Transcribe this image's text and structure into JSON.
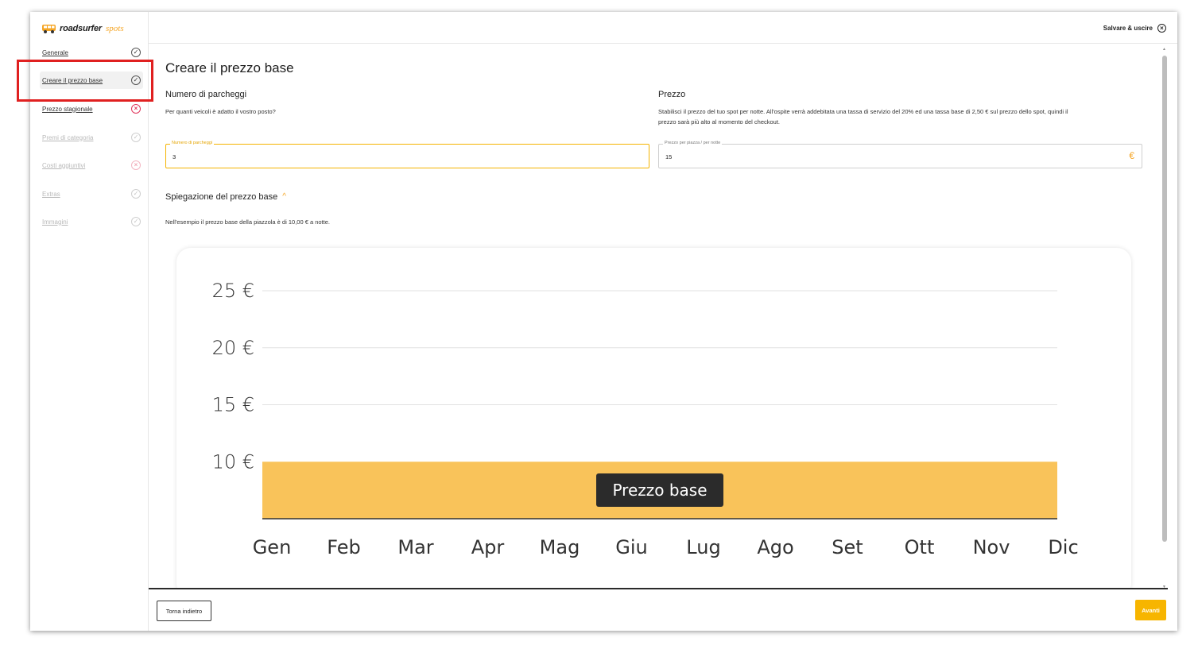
{
  "logo": {
    "brand": "roadsurfer",
    "suffix": "spots",
    "icon": "van-icon"
  },
  "sidebar": {
    "items": [
      {
        "label": "Generale",
        "status": "ok",
        "state": "enabled"
      },
      {
        "label": "Creare il prezzo base",
        "status": "ok",
        "state": "active"
      },
      {
        "label": "Prezzo stagionale",
        "status": "error",
        "state": "enabled"
      },
      {
        "label": "Premi di categoria",
        "status": "ok",
        "state": "disabled"
      },
      {
        "label": "Costi aggiuntivi",
        "status": "error",
        "state": "disabled"
      },
      {
        "label": "Extras",
        "status": "ok",
        "state": "disabled"
      },
      {
        "label": "Immagini",
        "status": "ok",
        "state": "disabled"
      }
    ]
  },
  "header": {
    "save_exit": "Salvare & uscire",
    "close_icon": "close-circle-icon"
  },
  "main": {
    "title": "Creare il prezzo base",
    "parking": {
      "title": "Numero di parcheggi",
      "description": "Per quanti veicoli è adatto il vostro posto?",
      "field_label": "Numero di parcheggi",
      "field_value": "3"
    },
    "price": {
      "title": "Prezzo",
      "description_line1": "Stabilisci il prezzo del tuo spot per notte. All'ospite verrà addebitata una tassa di servizio del 20% ed una tassa base di 2,50 € sul prezzo dello spot, quindi il",
      "description_line2": "prezzo sarà più alto al momento del checkout.",
      "field_label": "Prezzo per piazza / per notte",
      "field_value": "15",
      "currency": "€"
    },
    "explanation": {
      "title": "Spiegazione del prezzo base",
      "toggle_icon": "chevron-up-icon",
      "example": "Nell'esempio il prezzo base della piazzola è di 10,00 € a notte."
    }
  },
  "chart_data": {
    "type": "area",
    "categories": [
      "Gen",
      "Feb",
      "Mar",
      "Apr",
      "Mag",
      "Giu",
      "Lug",
      "Ago",
      "Set",
      "Ott",
      "Nov",
      "Dic"
    ],
    "series": [
      {
        "name": "Prezzo base",
        "values": [
          10,
          10,
          10,
          10,
          10,
          10,
          10,
          10,
          10,
          10,
          10,
          10
        ]
      }
    ],
    "yticks": [
      "10 €",
      "15 €",
      "20 €",
      "25 €"
    ],
    "ytick_values": [
      10,
      15,
      20,
      25
    ],
    "ylim": [
      5,
      25
    ],
    "grid": true,
    "fill_color": "#f9c35a",
    "label_bg": "#2b2b2b"
  },
  "footer": {
    "back_label": "Torna indietro",
    "next_label": "Avanti"
  },
  "colors": {
    "accent": "#f7b500",
    "error": "#e0355b",
    "highlight": "#e02020"
  }
}
